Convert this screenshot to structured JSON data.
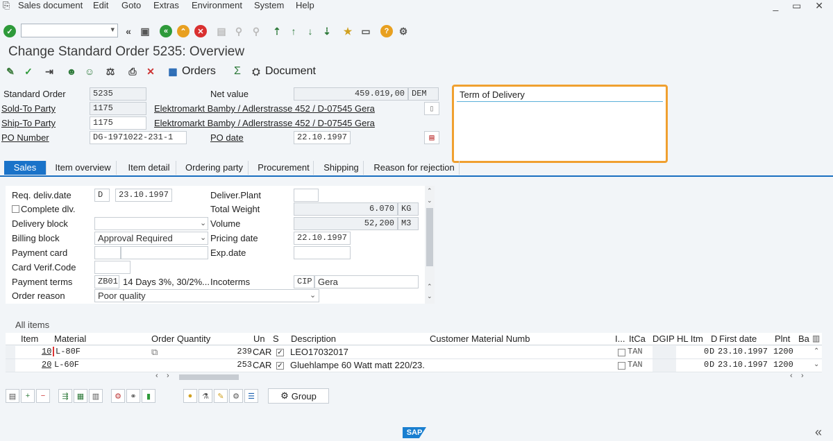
{
  "menu": [
    "Sales document",
    "Edit",
    "Goto",
    "Extras",
    "Environment",
    "System",
    "Help"
  ],
  "window_controls": "_ ▭ ✕",
  "page_title": "Change Standard Order 5235: Overview",
  "app_toolbar": {
    "orders_label": "Orders",
    "document_label": "Document",
    "sum_symbol": "Σ"
  },
  "header": {
    "standard_order": {
      "label": "Standard Order",
      "value": "5235"
    },
    "net_value": {
      "label": "Net value",
      "value": "459.019,00",
      "currency": "DEM"
    },
    "sold_to": {
      "label": "Sold-To Party",
      "value": "1175",
      "address": "Elektromarkt Bamby / Adlerstrasse 452 / D-07545 Gera"
    },
    "ship_to": {
      "label": "Ship-To Party",
      "value": "1175",
      "address": "Elektromarkt Bamby / Adlerstrasse 452 / D-07545 Gera"
    },
    "po_number": {
      "label": "PO Number",
      "value": "DG-1971022-231-1"
    },
    "po_date": {
      "label": "PO date",
      "value": "22.10.1997"
    },
    "term_of_delivery": "Term of Delivery"
  },
  "tabs": [
    "Sales",
    "Item overview",
    "Item detail",
    "Ordering party",
    "Procurement",
    "Shipping",
    "Reason for rejection"
  ],
  "sales": {
    "req_deliv_date": {
      "label": "Req. deliv.date",
      "type": "D",
      "value": "23.10.1997"
    },
    "deliver_plant": {
      "label": "Deliver.Plant",
      "value": ""
    },
    "complete_dlv": {
      "label": "Complete dlv.",
      "checked": false
    },
    "total_weight": {
      "label": "Total Weight",
      "value": "6.070",
      "unit": "KG"
    },
    "delivery_block": {
      "label": "Delivery block",
      "value": ""
    },
    "volume": {
      "label": "Volume",
      "value": "52,200",
      "unit": "M3"
    },
    "billing_block": {
      "label": "Billing block",
      "value": "Approval Required"
    },
    "pricing_date": {
      "label": "Pricing date",
      "value": "22.10.1997"
    },
    "payment_card": {
      "label": "Payment card",
      "value": ""
    },
    "exp_date": {
      "label": "Exp.date",
      "value": ""
    },
    "card_verif": {
      "label": "Card Verif.Code",
      "value": ""
    },
    "payment_terms": {
      "label": "Payment terms",
      "code": "ZB01",
      "value": "14 Days 3%, 30/2%..."
    },
    "incoterms": {
      "label": "Incoterms",
      "code": "CIP",
      "value": "Gera"
    },
    "order_reason": {
      "label": "Order reason",
      "value": "Poor quality"
    }
  },
  "items": {
    "title": "All items",
    "columns": [
      "Item",
      "Material",
      "Order Quantity",
      "Un",
      "S",
      "Description",
      "Customer Material Numb",
      "I...",
      "ItCa",
      "DGIP",
      "HL Itm",
      "D",
      "First date",
      "Plnt",
      "Ba"
    ],
    "rows": [
      {
        "item": "10",
        "material": "L-80F",
        "qty": "239",
        "un": "CAR",
        "s": true,
        "description": "LEO17032017",
        "cust_mat": "",
        "itca": "TAN",
        "d": "D",
        "first_date": "23.10.1997",
        "plnt": "1200"
      },
      {
        "item": "20",
        "material": "L-60F",
        "qty": "253",
        "un": "CAR",
        "s": true,
        "description": "Gluehlampe 60 Watt matt 220/23...",
        "cust_mat": "",
        "itca": "TAN",
        "d": "D",
        "first_date": "23.10.1997",
        "plnt": "1200"
      }
    ],
    "hl_itm": [
      "0",
      "0"
    ]
  },
  "bottom_toolbar": {
    "group_label": "Group"
  },
  "footer": {
    "logo": "SAP",
    "collapse": "«"
  },
  "colors": {
    "accent": "#1a73c9",
    "highlight": "#f0a030"
  }
}
